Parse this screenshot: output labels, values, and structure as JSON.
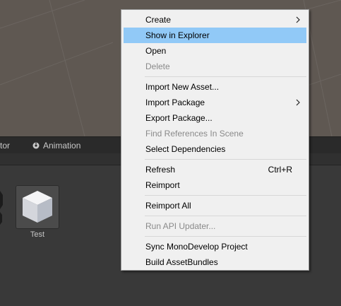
{
  "panel_tabs": {
    "inspector_partial": "tor",
    "animation": "Animation"
  },
  "asset": {
    "name": "Test"
  },
  "context_menu": {
    "create": "Create",
    "show_in_explorer": "Show in Explorer",
    "open": "Open",
    "delete": "Delete",
    "import_new_asset": "Import New Asset...",
    "import_package": "Import Package",
    "export_package": "Export Package...",
    "find_references": "Find References In Scene",
    "select_dependencies": "Select Dependencies",
    "refresh": "Refresh",
    "refresh_shortcut": "Ctrl+R",
    "reimport": "Reimport",
    "reimport_all": "Reimport All",
    "run_api_updater": "Run API Updater...",
    "sync_monodevelop": "Sync MonoDevelop Project",
    "build_assetbundles": "Build AssetBundles"
  },
  "colors": {
    "menu_bg": "#f0f0f0",
    "highlight": "#91c9f7",
    "disabled_text": "#8a8a8a",
    "scene_bg": "#5f5852"
  }
}
